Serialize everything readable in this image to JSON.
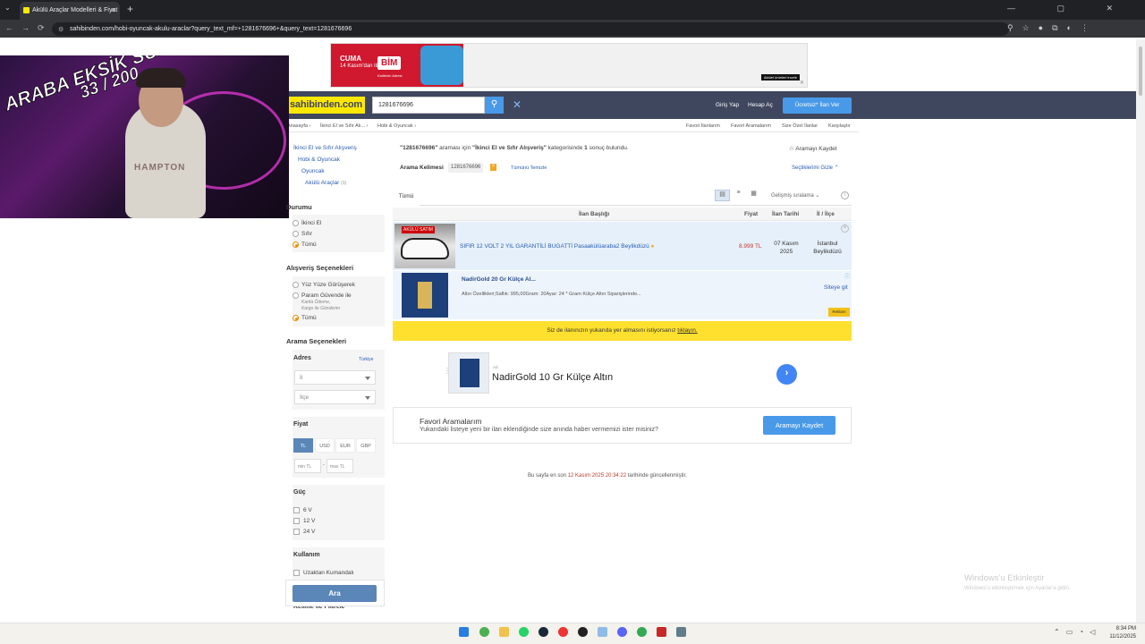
{
  "browser": {
    "tab_title": "Akülü Araçlar Modelleri & Fiyat",
    "url": "sahibinden.com/hobi-oyuncak-akulu-araclar?query_text_mf=+1281676696+&query_text=1281676696",
    "new_tab": "+",
    "tab_close": "×",
    "window_controls": "— ▢ ✕"
  },
  "stream_overlay": {
    "line1": "ARABA EKSİK SUB",
    "counter": "33 / 200",
    "shirt_text": "HAMPTON"
  },
  "banner": {
    "cuma": "CUMA",
    "date": "14 Kasım'dan itibaren",
    "brand": "BİM",
    "sub": "Kalitenin Adresi",
    "cta": "Aktüel ürünleri incele",
    "close": "✕"
  },
  "header": {
    "logo": "sahibinden.com",
    "search_value": "1281676696",
    "login": "Giriş Yap",
    "register": "Hesap Aç",
    "post_ad": "Ücretsiz* İlan Ver"
  },
  "breadcrumb": [
    "Anasayfa ›",
    "İkinci El ve Sıfır Alı... ›",
    "Hobi & Oyuncak ›"
  ],
  "top_links": [
    "Favori İlanlarım",
    "Favori Aramalarım",
    "Size Özel İlanlar",
    "Karşılaştır"
  ],
  "sidebar": {
    "categories": [
      "İkinci El ve Sıfır Alışveriş",
      "Hobi & Oyuncak",
      "Oyuncak",
      "Akülü Araçlar"
    ],
    "category_count": "(1)",
    "condition_title": "Durumu",
    "condition_options": [
      "İkinci El",
      "Sıfır",
      "Tümü"
    ],
    "shopping_title": "Alışveriş Seçenekleri",
    "shopping_options": [
      "Yüz Yüze Görüşerek",
      "Param Güvende ile",
      "Tümü"
    ],
    "shopping_sub": [
      "Kartla Ödeme,",
      "Kargo ile Gönderim"
    ],
    "search_options_title": "Arama Seçenekleri",
    "address_title": "Adres",
    "address_country": "Türkiye",
    "city_placeholder": "İl",
    "district_placeholder": "İlçe",
    "price_title": "Fiyat",
    "currencies": [
      "TL",
      "USD",
      "EUR",
      "GBP"
    ],
    "min_price": "min TL",
    "max_price": "max TL",
    "price_sep": "-",
    "power_title": "Güç",
    "power_options": [
      "6 V",
      "12 V",
      "24 V"
    ],
    "usage_title": "Kullanım",
    "usage_options": [
      "Uzaktan Kumandalı"
    ],
    "keyword_filter": "Kelime ile Filtrele",
    "search_button": "Ara"
  },
  "results": {
    "info_quote": "\"1281676696\"",
    "info_mid": " araması için ",
    "info_cat": "\"İkinci El ve Sıfır Alışveriş\"",
    "info_tail": " kategorisinde ",
    "info_count": "1",
    "info_end": " sonuç bulundu.",
    "save_search": "☆ Aramayı Kaydet",
    "keyword_label": "Arama Kelimesi",
    "keyword_value": "1281676696",
    "clear_all": "Tümünü Temizle",
    "hide_selected": "Seçtiklerimi Gizle ⌃",
    "tab_all": "Tümü",
    "sort": "Gelişmiş sıralama",
    "columns": [
      "İlan Başlığı",
      "Fiyat",
      "İlan Tarihi",
      "İl / İlçe"
    ],
    "listing": {
      "title": "SIFIR 12 VOLT 2 YIL GARANTİLİ BUGATTİ Pasaakülüaraba2 Beylikdüzü",
      "price": "8.999 TL",
      "date_line1": "07 Kasım",
      "date_line2": "2025",
      "loc_line1": "İstanbul",
      "loc_line2": "Beylikdüzü",
      "thumb_tag": "AKÜLÜ SATIM"
    },
    "sponsored": {
      "title": "NadirGold 20 Gr Külçe Al...",
      "desc": "Altın Özellikleri;Saflık: 995,00Gram: 20Ayar: 24 * Gram Külçe Altın Siparişlerinde...",
      "site_link": "Siteye git",
      "badge": "Reklam"
    },
    "promo_text": "Siz de ilanınızın yukarıda yer almasını istiyorsanız ",
    "promo_link": "tıklayın."
  },
  "ad2": {
    "label": "Ad",
    "title": "NadirGold 10 Gr Külçe Altın",
    "arrow": "›"
  },
  "fav_search": {
    "title": "Favori Aramalarım",
    "desc": "Yukarıdaki listeye yeni bir ilan eklendiğinde size anında haber vermemizi ister misiniz?",
    "button": "Aramayı Kaydet"
  },
  "updated": {
    "prefix": "Bu sayfa en son ",
    "date": "12 Kasım 2025 20:34:22",
    "suffix": " tarihinde güncellenmiştir."
  },
  "windows_activation": {
    "title": "Windows'u Etkinleştir",
    "desc": "Windows'u etkinleştirmek için Ayarlar'a gidin."
  },
  "taskbar": {
    "time": "8:34 PM",
    "date": "11/12/2025"
  }
}
